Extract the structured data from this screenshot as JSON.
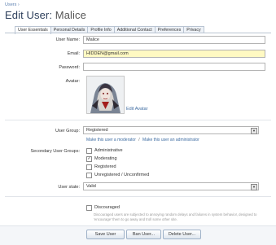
{
  "breadcrumb": "Users ›",
  "page_title_prefix": "Edit User:",
  "page_title_name": "Malice",
  "tabs": [
    "User Essentials",
    "Personal Details",
    "Profile Info",
    "Additional Contact",
    "Preferences",
    "Privacy"
  ],
  "fields": {
    "user_name": {
      "label": "User Name:",
      "value": "Malice"
    },
    "email": {
      "label": "Email:",
      "value": "HIDDEN@gmail.com"
    },
    "password": {
      "label": "Password:",
      "value": ""
    },
    "avatar": {
      "label": "Avatar:",
      "edit_link": "Edit Avatar"
    }
  },
  "user_group": {
    "label": "User Group:",
    "value": "Registered"
  },
  "mod_links": {
    "make_moderator": "Make this user a moderator",
    "separator": "/",
    "make_admin": "Make this user an administrator"
  },
  "secondary_groups": {
    "label": "Secondary User Groups:",
    "items": [
      {
        "label": "Administrative",
        "checked": false,
        "mark": ""
      },
      {
        "label": "Moderating",
        "checked": true,
        "mark": "✓"
      },
      {
        "label": "Registered",
        "checked": false,
        "mark": ""
      },
      {
        "label": "Unregistered / Unconfirmed",
        "checked": false,
        "mark": ""
      }
    ]
  },
  "user_state": {
    "label": "User state:",
    "value": "Valid"
  },
  "discouraged": {
    "label": "Discouraged",
    "note": "Discouraged users are subjected to annoying random delays and failures in system behavior, designed to 'encourage' them to go away and troll some other site."
  },
  "buttons": {
    "save": "Save User",
    "ban": "Ban User...",
    "delete": "Delete User..."
  },
  "colors": {
    "accent": "#3b6aa0",
    "email_highlight": "#fff9c2"
  }
}
